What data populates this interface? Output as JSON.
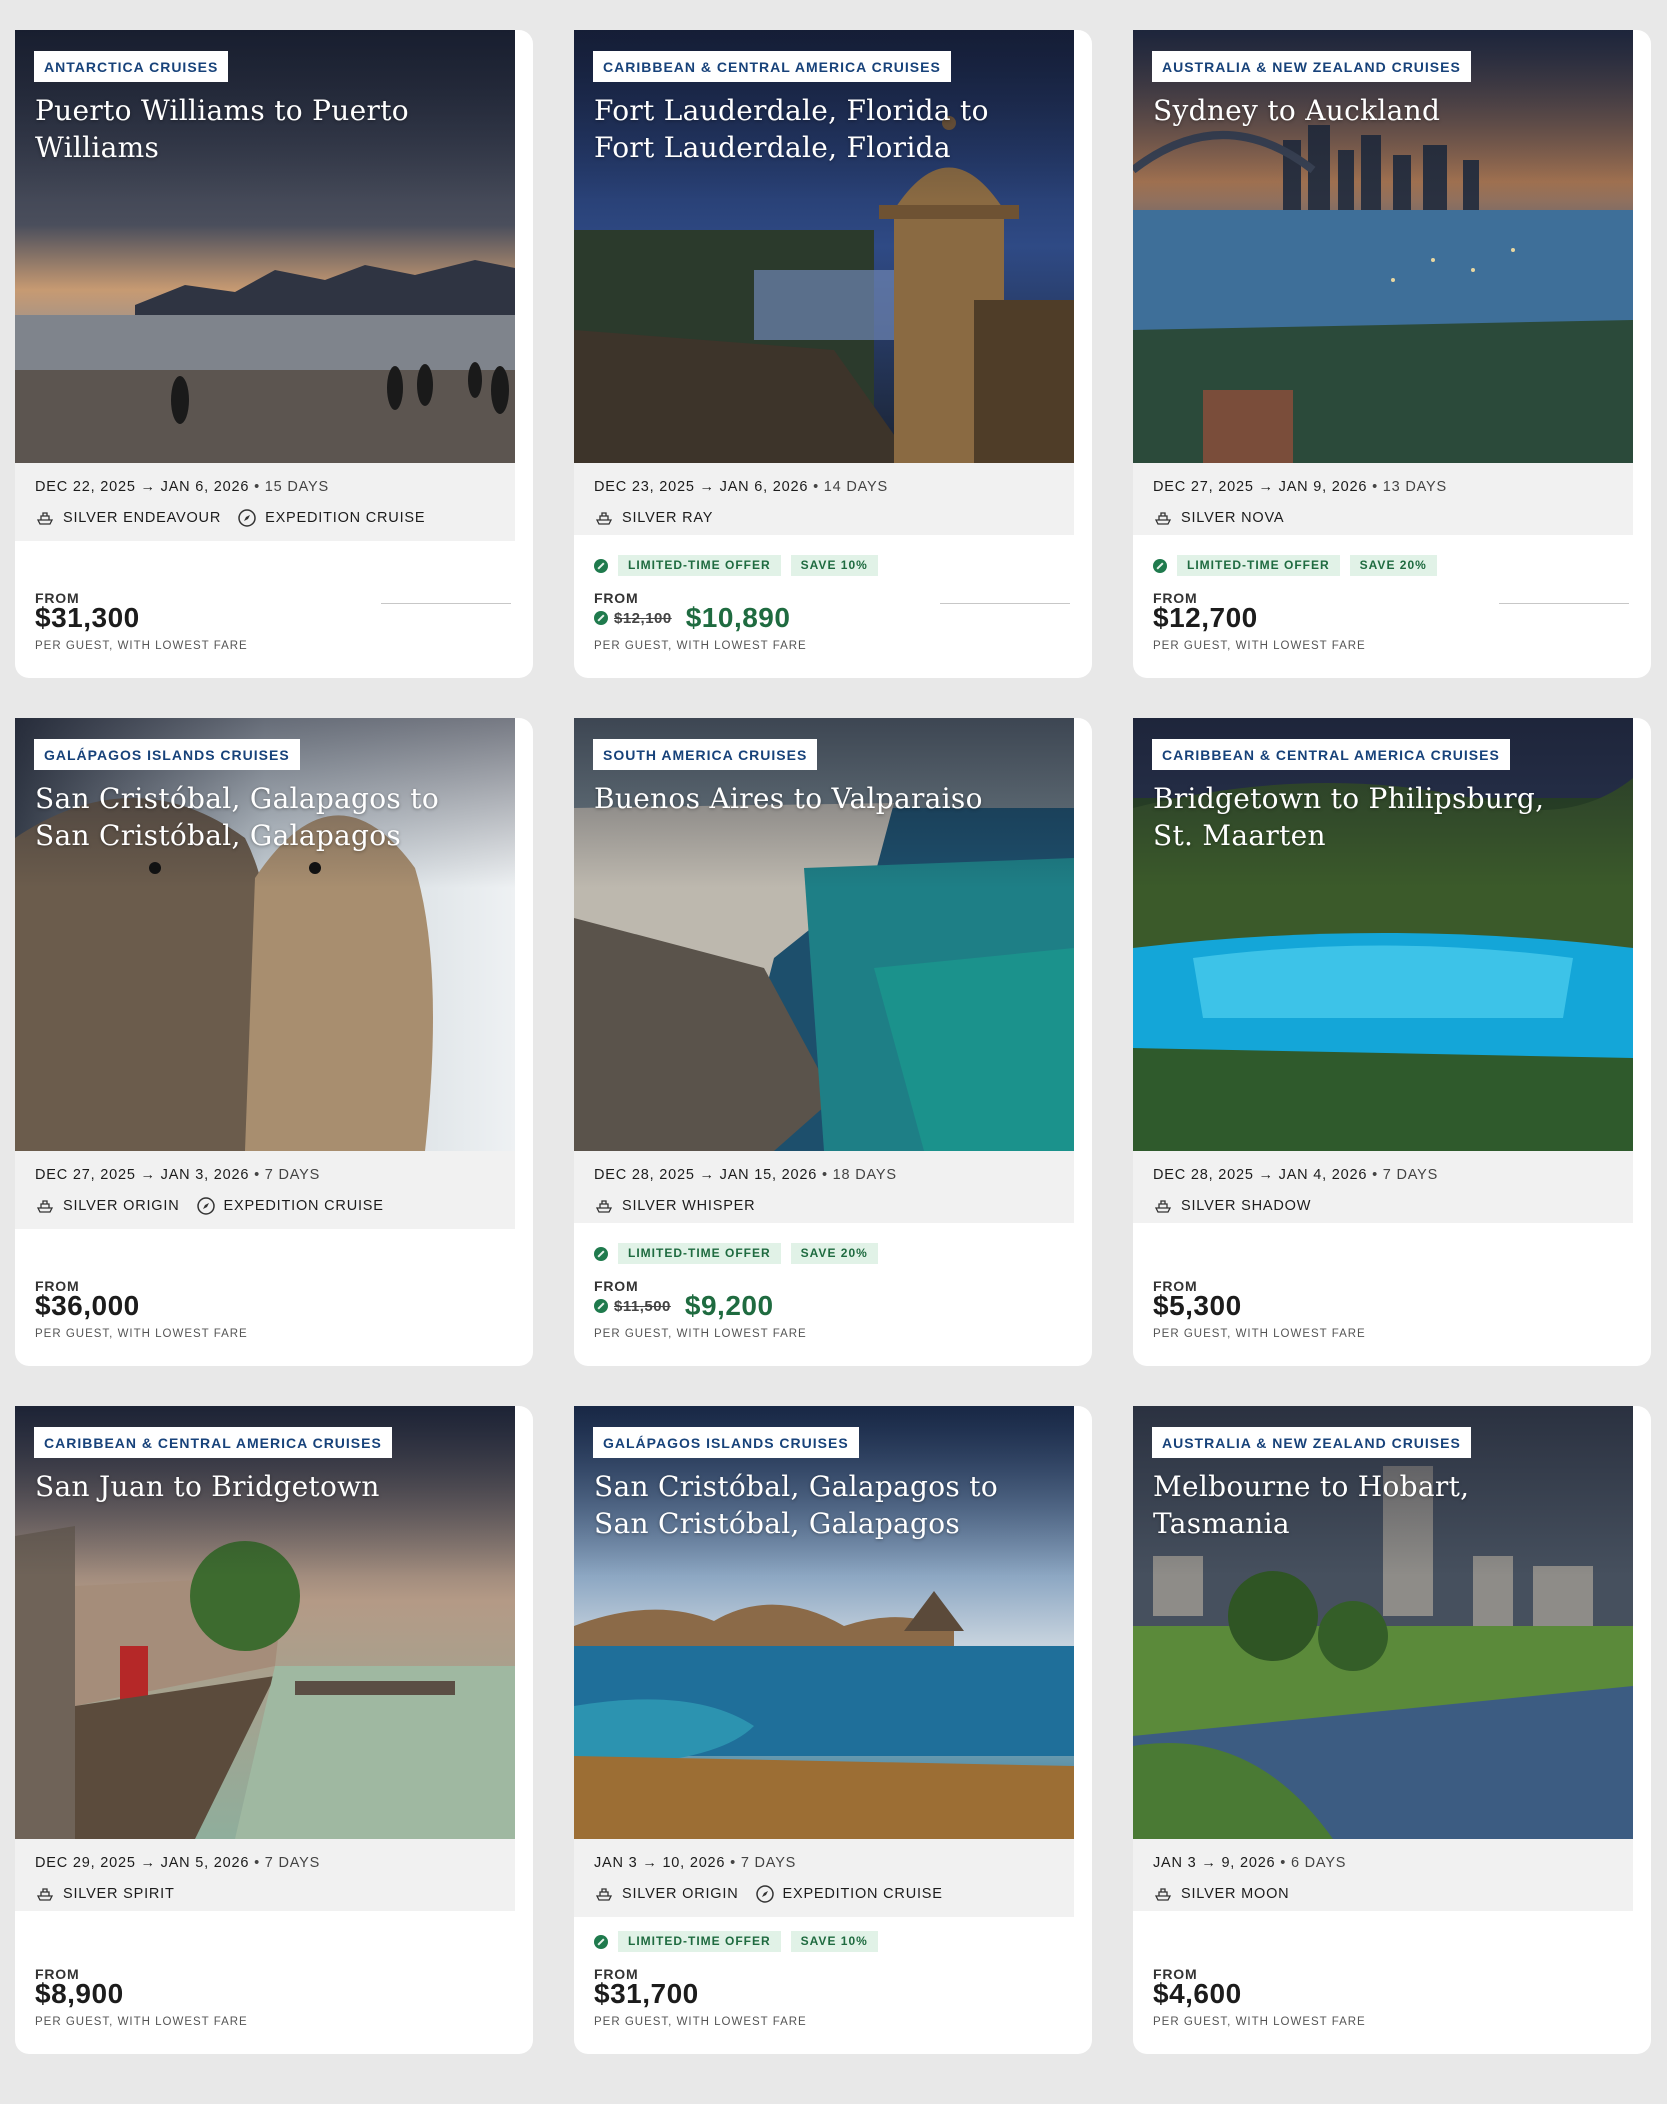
{
  "cards": [
    {
      "region": "ANTARCTICA CRUISES",
      "title": "Puerto Williams to Puerto Williams",
      "dates": "DEC 22, 2025 → JAN 6, 2026",
      "duration": "• 15 DAYS",
      "ship": "SILVER ENDEAVOUR",
      "expedition": "EXPEDITION CRUISE",
      "from_label": "FROM",
      "price": "$31,300",
      "note": "PER GUEST, WITH LOWEST FARE",
      "image": "penguins-beach-mountains"
    },
    {
      "region": "CARIBBEAN & CENTRAL AMERICA CRUISES",
      "title": "Fort Lauderdale, Florida to Fort Lauderdale, Florida",
      "dates": "DEC 23, 2025 → JAN 6, 2026",
      "duration": "• 14 DAYS",
      "ship": "SILVER RAY",
      "offer": "LIMITED-TIME OFFER",
      "save": "SAVE 10%",
      "from_label": "FROM",
      "was": "$12,100",
      "price": "$10,890",
      "note": "PER GUEST, WITH LOWEST FARE",
      "image": "fort-sentry-box-dusk"
    },
    {
      "region": "AUSTRALIA & NEW ZEALAND CRUISES",
      "title": "Sydney to Auckland",
      "dates": "DEC 27, 2025 → JAN 9, 2026",
      "duration": "• 13 DAYS",
      "ship": "SILVER NOVA",
      "offer": "LIMITED-TIME OFFER",
      "save": "SAVE 20%",
      "from_label": "FROM",
      "price": "$12,700",
      "note": "PER GUEST, WITH LOWEST FARE",
      "image": "sydney-harbour-night"
    },
    {
      "region": "GALÁPAGOS ISLANDS CRUISES",
      "title": "San Cristóbal, Galapagos to San Cristóbal, Galapagos",
      "dates": "DEC 27, 2025 → JAN 3, 2026",
      "duration": "• 7 DAYS",
      "ship": "SILVER ORIGIN",
      "expedition": "EXPEDITION CRUISE",
      "from_label": "FROM",
      "price": "$36,000",
      "note": "PER GUEST, WITH LOWEST FARE",
      "image": "sea-lions"
    },
    {
      "region": "SOUTH AMERICA CRUISES",
      "title": "Buenos Aires to Valparaiso",
      "dates": "DEC 28, 2025 → JAN 15, 2026",
      "duration": "• 18 DAYS",
      "ship": "SILVER WHISPER",
      "offer": "LIMITED-TIME OFFER",
      "save": "SAVE 20%",
      "from_label": "FROM",
      "was": "$11,500",
      "price": "$9,200",
      "note": "PER GUEST, WITH LOWEST FARE",
      "image": "coastal-cliffs-seals"
    },
    {
      "region": "CARIBBEAN & CENTRAL AMERICA CRUISES",
      "title": "Bridgetown to Philipsburg, St. Maarten",
      "dates": "DEC 28, 2025 → JAN 4, 2026",
      "duration": "• 7 DAYS",
      "ship": "SILVER SHADOW",
      "from_label": "FROM",
      "price": "$5,300",
      "note": "PER GUEST, WITH LOWEST FARE",
      "image": "turquoise-bay-hills"
    },
    {
      "region": "CARIBBEAN & CENTRAL AMERICA CRUISES",
      "title": "San Juan to Bridgetown",
      "dates": "DEC 29, 2025 → JAN 5, 2026",
      "duration": "• 7 DAYS",
      "ship": "SILVER SPIRIT",
      "from_label": "FROM",
      "price": "$8,900",
      "note": "PER GUEST, WITH LOWEST FARE",
      "image": "old-san-juan-gate"
    },
    {
      "region": "GALÁPAGOS ISLANDS CRUISES",
      "title": "San Cristóbal, Galapagos to San Cristóbal, Galapagos",
      "dates": "JAN 3 → 10, 2026",
      "duration": "• 7 DAYS",
      "ship": "SILVER ORIGIN",
      "expedition": "EXPEDITION CRUISE",
      "offer": "LIMITED-TIME OFFER",
      "save": "SAVE 10%",
      "from_label": "FROM",
      "price": "$31,700",
      "note": "PER GUEST, WITH LOWEST FARE",
      "image": "galapagos-pinnacle-rock"
    },
    {
      "region": "AUSTRALIA & NEW ZEALAND CRUISES",
      "title": "Melbourne to Hobart, Tasmania",
      "dates": "JAN 3 → 9, 2026",
      "duration": "• 6 DAYS",
      "ship": "SILVER MOON",
      "from_label": "FROM",
      "price": "$4,600",
      "note": "PER GUEST, WITH LOWEST FARE",
      "image": "city-park-river"
    }
  ]
}
